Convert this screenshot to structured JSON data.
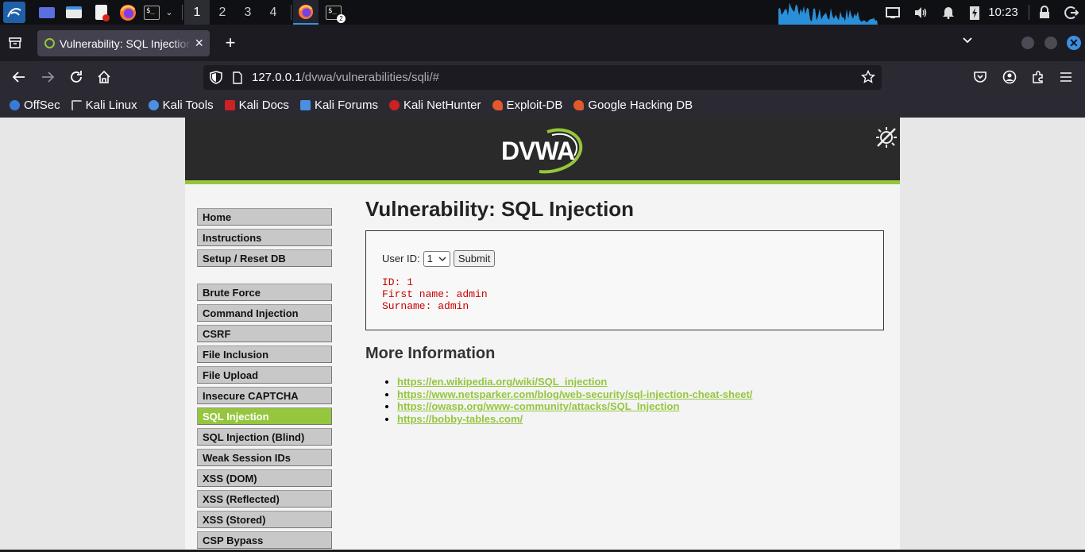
{
  "taskbar": {
    "workspaces": [
      "1",
      "2",
      "3",
      "4"
    ],
    "terminal_badge": "2",
    "clock": "10:23"
  },
  "tab": {
    "title": "Vulnerability: SQL Injection",
    "close": "×",
    "new_tab": "+"
  },
  "url": {
    "host": "127.0.0.1",
    "path": "/dvwa/vulnerabilities/sqli/#"
  },
  "bookmarks": [
    {
      "label": "OffSec",
      "color": "#3a7bd5"
    },
    {
      "label": "Kali Linux",
      "color": "#bbbbbb"
    },
    {
      "label": "Kali Tools",
      "color": "#4a8fe0"
    },
    {
      "label": "Kali Docs",
      "color": "#cc2222"
    },
    {
      "label": "Kali Forums",
      "color": "#4a8fe0"
    },
    {
      "label": "Kali NetHunter",
      "color": "#cc2222"
    },
    {
      "label": "Exploit-DB",
      "color": "#e0582b"
    },
    {
      "label": "Google Hacking DB",
      "color": "#e0582b"
    }
  ],
  "dvwa": {
    "logo": "DVWA",
    "accent": "#95c63d",
    "menu_top": [
      "Home",
      "Instructions",
      "Setup / Reset DB"
    ],
    "menu_vulns": [
      "Brute Force",
      "Command Injection",
      "CSRF",
      "File Inclusion",
      "File Upload",
      "Insecure CAPTCHA",
      "SQL Injection",
      "SQL Injection (Blind)",
      "Weak Session IDs",
      "XSS (DOM)",
      "XSS (Reflected)",
      "XSS (Stored)",
      "CSP Bypass"
    ],
    "selected": "SQL Injection",
    "heading": "Vulnerability: SQL Injection",
    "form": {
      "user_id_label": "User ID:",
      "user_id_value": "1",
      "submit_label": "Submit"
    },
    "output": [
      "ID: 1",
      "First name: admin",
      "Surname: admin"
    ],
    "more_info_heading": "More Information",
    "links": [
      "https://en.wikipedia.org/wiki/SQL_injection",
      "https://www.netsparker.com/blog/web-security/sql-injection-cheat-sheet/",
      "https://owasp.org/www-community/attacks/SQL_Injection",
      "https://bobby-tables.com/"
    ]
  }
}
